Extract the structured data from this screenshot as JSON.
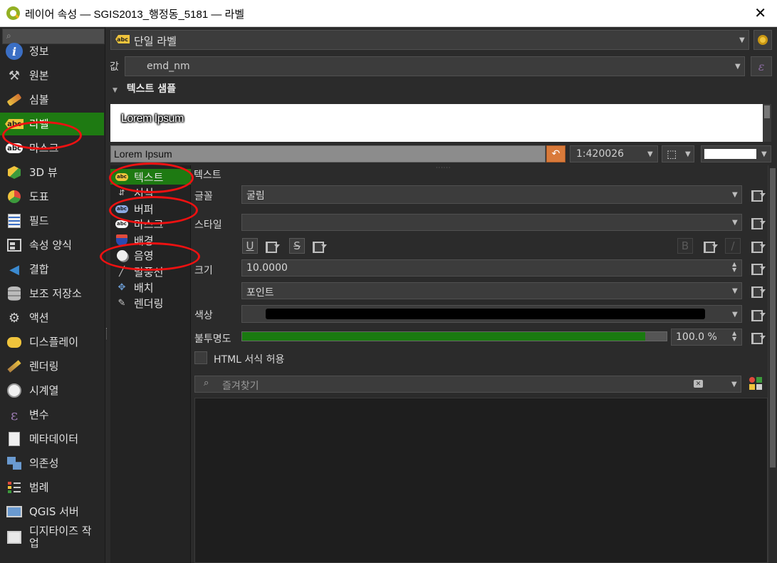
{
  "window": {
    "title": "레이어 속성 — SGIS2013_행정동_5181 — 라벨",
    "close_glyph": "✕"
  },
  "nav": {
    "items": [
      {
        "label": "정보",
        "icon": "info-icon"
      },
      {
        "label": "원본",
        "icon": "source-tools-icon"
      },
      {
        "label": "심볼",
        "icon": "symbology-brush-icon"
      },
      {
        "label": "라벨",
        "icon": "label-abc-icon"
      },
      {
        "label": "마스크",
        "icon": "mask-abc-icon"
      },
      {
        "label": "3D 뷰",
        "icon": "cube-3d-icon"
      },
      {
        "label": "도표",
        "icon": "diagram-icon"
      },
      {
        "label": "필드",
        "icon": "fields-icon"
      },
      {
        "label": "속성 양식",
        "icon": "attribute-form-icon"
      },
      {
        "label": "결합",
        "icon": "join-icon"
      },
      {
        "label": "보조 저장소",
        "icon": "auxiliary-storage-icon"
      },
      {
        "label": "액션",
        "icon": "action-gear-icon"
      },
      {
        "label": "디스플레이",
        "icon": "display-tip-icon"
      },
      {
        "label": "렌더링",
        "icon": "rendering-brush-icon"
      },
      {
        "label": "시계열",
        "icon": "clock-icon"
      },
      {
        "label": "변수",
        "icon": "variable-epsilon-icon"
      },
      {
        "label": "메타데이터",
        "icon": "metadata-icon"
      },
      {
        "label": "의존성",
        "icon": "dependencies-icon"
      },
      {
        "label": "범례",
        "icon": "legend-icon"
      },
      {
        "label": "QGIS 서버",
        "icon": "qgis-server-icon"
      },
      {
        "label": "디지타이즈 작업",
        "icon": "digitizing-icon"
      }
    ],
    "active_index": 3
  },
  "label_mode": {
    "value": "단일 라벨",
    "icon": "abc-icon"
  },
  "value_field": {
    "label": "값",
    "value": "emd_nm",
    "expr_glyph": "ε"
  },
  "sample": {
    "header": "텍스트 샘플",
    "preview_text": "Lorem Ipsum",
    "input_value": "Lorem Ipsum",
    "scale": "1:420026",
    "background_color": "#ffffff"
  },
  "subnav": {
    "items": [
      {
        "label": "텍스트",
        "icon": "text-abc-icon"
      },
      {
        "label": "서식",
        "icon": "formatting-icon"
      },
      {
        "label": "버퍼",
        "icon": "buffer-abc-icon"
      },
      {
        "label": "마스크",
        "icon": "mask-abc-icon"
      },
      {
        "label": "배경",
        "icon": "background-shield-icon"
      },
      {
        "label": "음영",
        "icon": "shadow-icon"
      },
      {
        "label": "말풍선",
        "icon": "callout-icon"
      },
      {
        "label": "배치",
        "icon": "placement-icon"
      },
      {
        "label": "렌더링",
        "icon": "rendering-pen-icon"
      }
    ],
    "active_index": 0
  },
  "text_panel": {
    "title": "텍스트",
    "font_label": "글꼴",
    "font_value": "굴림",
    "style_label": "스타일",
    "style_value": "",
    "underline_glyph": "U",
    "strike_glyph": "S",
    "bold_glyph": "B",
    "italic_glyph": "/",
    "size_label": "크기",
    "size_value": "10.0000",
    "unit_value": "포인트",
    "color_label": "색상",
    "text_color": "#000000",
    "opacity_label": "불투명도",
    "opacity_value": "100.0 %",
    "opacity_fraction": 0.95,
    "html_label": "HTML 서식 허용",
    "html_checked": false,
    "favorites_placeholder": "즐겨찾기"
  },
  "colors": {
    "accent_green": "#1e7a12",
    "annotation_red": "#e11111"
  }
}
